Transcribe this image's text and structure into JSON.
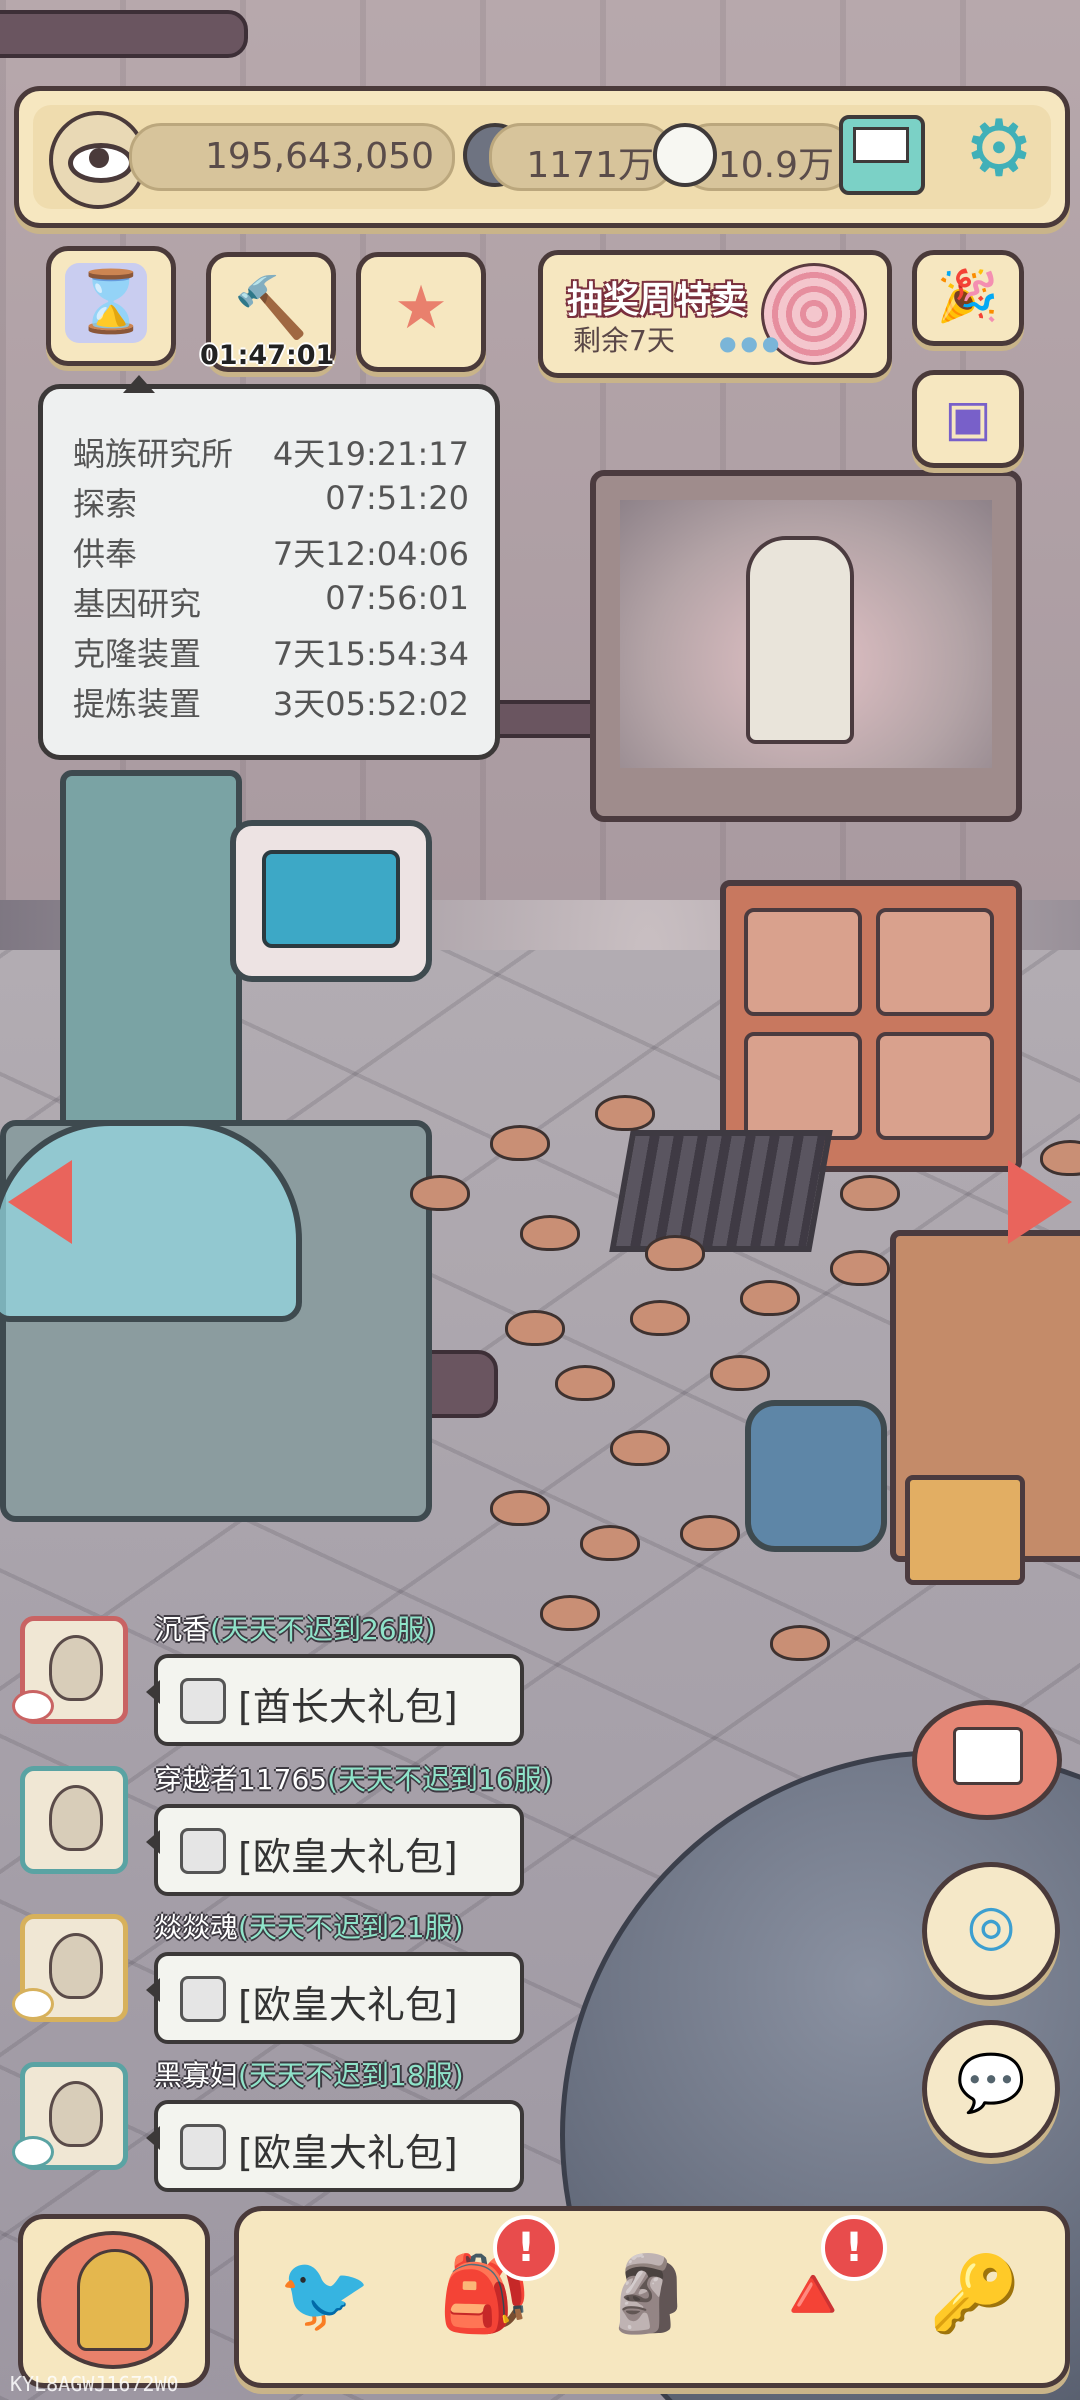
{
  "top_bar": {
    "views": "195,643,050",
    "currency_1": "1171万",
    "currency_2": "10.9万"
  },
  "quick_buttons": {
    "hourglass_timer": "01:47:01"
  },
  "promo": {
    "title": "抽奖周特卖",
    "subtitle": "剩余7天"
  },
  "timers_popover": {
    "rows": [
      {
        "name": "蜗族研究所",
        "time": "4天19:21:17"
      },
      {
        "name": "探索",
        "time": "07:51:20"
      },
      {
        "name": "供奉",
        "time": "7天12:04:06"
      },
      {
        "name": "基因研究",
        "time": "07:56:01"
      },
      {
        "name": "克隆装置",
        "time": "7天15:54:34"
      },
      {
        "name": "提炼装置",
        "time": "3天05:52:02"
      }
    ]
  },
  "chat": {
    "messages": [
      {
        "name": "沉香",
        "tag": "(天天不迟到26服)",
        "text": "[酋长大礼包]"
      },
      {
        "name": "穿越者11765",
        "tag": "(天天不迟到16服)",
        "text": "[欧皇大礼包]"
      },
      {
        "name": "燚燚魂",
        "tag": "(天天不迟到21服)",
        "text": "[欧皇大礼包]"
      },
      {
        "name": "黑寡妇",
        "tag": "(天天不迟到18服)",
        "text": "[欧皇大礼包]"
      }
    ]
  },
  "bottom_bar": {
    "alerts": [
      "!",
      "!"
    ]
  },
  "footer_code": "KYL8AGWJ1672W0",
  "colors": {
    "panel": "#f6e7c0",
    "outline": "#4a3a3a",
    "alert": "#e84c4c",
    "chat_tag": "#8fe3c9"
  }
}
